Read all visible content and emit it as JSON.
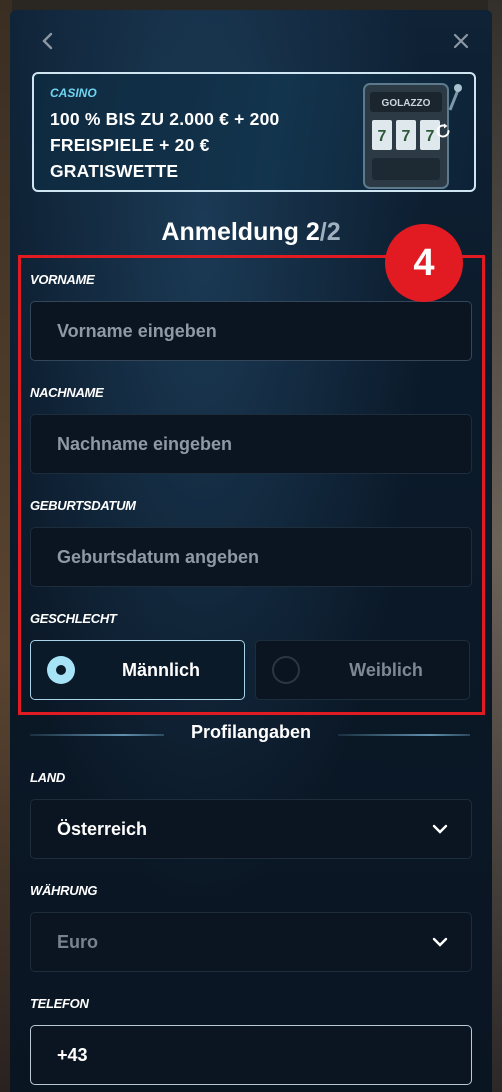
{
  "banner": {
    "tag": "CASINO",
    "headline": "100 % BIS ZU 2.000 € + 200 FREISPIELE + 20 € GRATISWETTE",
    "slot_brand": "GOLAZZO"
  },
  "step": {
    "title": "Anmeldung",
    "current": "2",
    "separator": "/",
    "total": "2",
    "annotation_number": "4"
  },
  "form": {
    "firstname": {
      "label": "VORNAME",
      "placeholder": "Vorname eingeben"
    },
    "lastname": {
      "label": "NACHNAME",
      "placeholder": "Nachname eingeben"
    },
    "birthdate": {
      "label": "GEBURTSDATUM",
      "placeholder": "Geburtsdatum angeben"
    },
    "gender": {
      "label": "GESCHLECHT",
      "options": [
        {
          "label": "Männlich",
          "selected": true
        },
        {
          "label": "Weiblich",
          "selected": false
        }
      ]
    }
  },
  "profile": {
    "heading": "Profilangaben",
    "country": {
      "label": "LAND",
      "value": "Österreich"
    },
    "currency": {
      "label": "WÄHRUNG",
      "value": "Euro"
    },
    "phone": {
      "label": "TELEFON",
      "value": "+43"
    }
  },
  "colors": {
    "highlight": "#e01b22",
    "accent": "#6fd4f2",
    "modal_bg": "#0b1a2a"
  },
  "icons": [
    "chevron-left-icon",
    "close-icon",
    "refresh-icon",
    "radio-selected-icon",
    "radio-unselected-icon",
    "chevron-down-icon"
  ]
}
